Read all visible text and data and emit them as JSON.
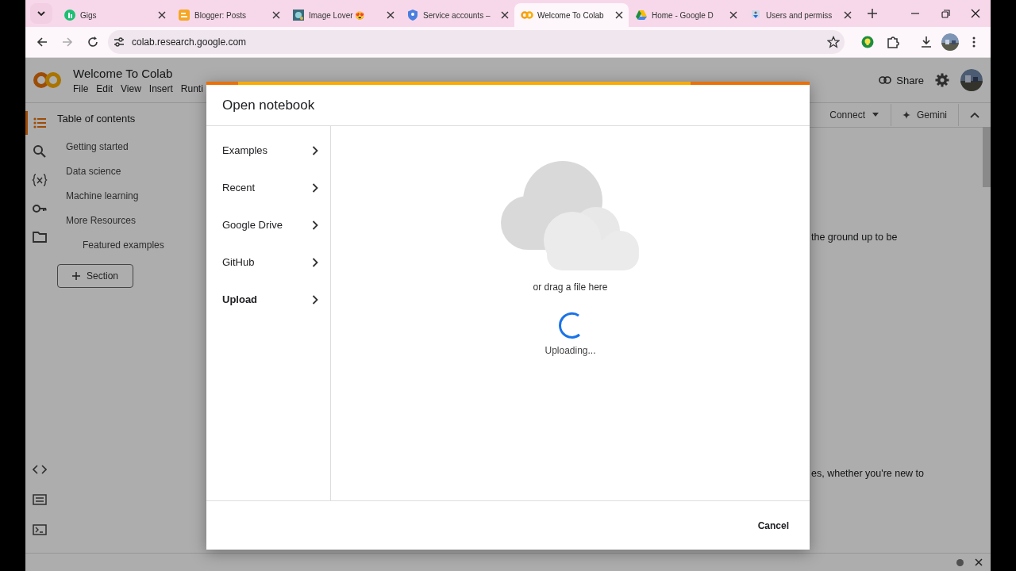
{
  "browser": {
    "tabs": [
      {
        "title": "Gigs",
        "selected": false
      },
      {
        "title": "Blogger: Posts",
        "selected": false
      },
      {
        "title": "Image Lover 😍",
        "selected": false
      },
      {
        "title": "Service accounts –",
        "selected": false
      },
      {
        "title": "Welcome To Colab",
        "selected": true
      },
      {
        "title": "Home - Google D",
        "selected": false
      },
      {
        "title": "Users and permiss",
        "selected": false
      }
    ],
    "url": "colab.research.google.com"
  },
  "notebook": {
    "title": "Welcome To Colab",
    "menu": [
      "File",
      "Edit",
      "View",
      "Insert",
      "Runti"
    ],
    "share": "Share",
    "connect": "Connect",
    "gemini": "Gemini",
    "rail": [
      {
        "kind": "toc",
        "selected": true
      },
      {
        "kind": "search",
        "selected": false
      },
      {
        "kind": "variables",
        "selected": false
      },
      {
        "kind": "key",
        "selected": false
      },
      {
        "kind": "folder",
        "selected": false
      }
    ],
    "toc_title": "Table of contents",
    "toc": [
      {
        "label": "Getting started"
      },
      {
        "label": "Data science"
      },
      {
        "label": "Machine learning"
      },
      {
        "label": "More Resources",
        "children": [
          {
            "label": "Featured examples"
          }
        ]
      }
    ],
    "section_button": "Section",
    "text_lines": [
      "the ground up to be",
      "es, whether you're new to"
    ]
  },
  "dialog": {
    "title": "Open notebook",
    "nav": [
      {
        "label": "Examples",
        "selected": false
      },
      {
        "label": "Recent",
        "selected": false
      },
      {
        "label": "Google Drive",
        "selected": false
      },
      {
        "label": "GitHub",
        "selected": false
      },
      {
        "label": "Upload",
        "selected": true
      }
    ],
    "drop_hint": "or drag a file here",
    "status": "Uploading...",
    "cancel": "Cancel"
  }
}
